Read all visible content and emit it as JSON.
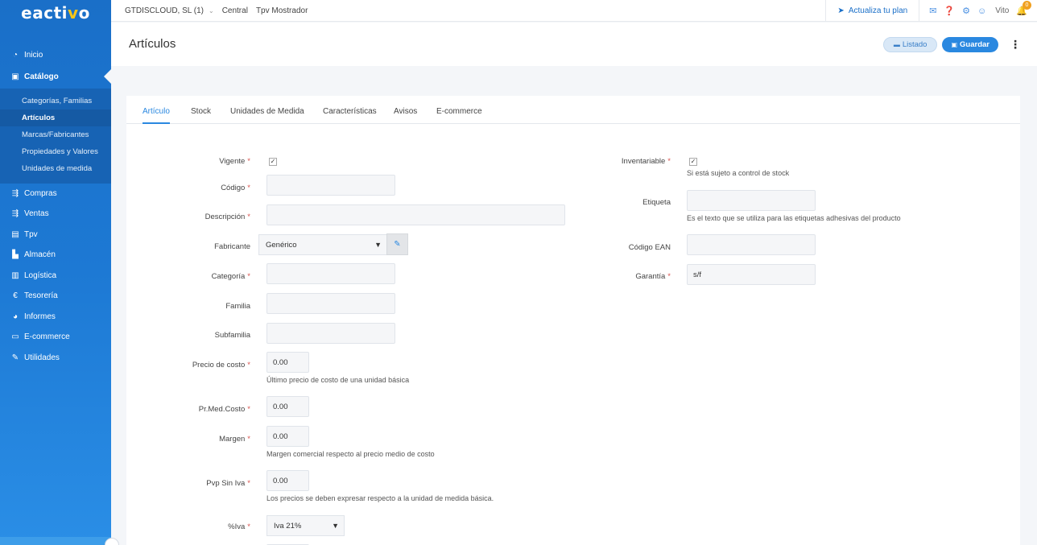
{
  "logo": {
    "text_main": "eacti",
    "text_accent": "v",
    "text_end": "o"
  },
  "topbar": {
    "company": "GTDISCLOUD, SL (1)",
    "crumbs": [
      "Central",
      "Tpv Mostrador"
    ],
    "plan_label": "Actualiza tu plan",
    "user": "Vito",
    "notifications": "0"
  },
  "sidebar": {
    "items": [
      {
        "label": "Inicio",
        "icon": "dashboard-icon"
      },
      {
        "label": "Catálogo",
        "icon": "catalog-icon"
      },
      {
        "label": "Compras",
        "icon": "purchases-icon"
      },
      {
        "label": "Ventas",
        "icon": "sales-icon"
      },
      {
        "label": "Tpv",
        "icon": "pos-icon"
      },
      {
        "label": "Almacén",
        "icon": "warehouse-icon"
      },
      {
        "label": "Logística",
        "icon": "logistics-icon"
      },
      {
        "label": "Tesorería",
        "icon": "euro-icon"
      },
      {
        "label": "Informes",
        "icon": "pie-chart-icon"
      },
      {
        "label": "E-commerce",
        "icon": "ecommerce-icon"
      },
      {
        "label": "Utilidades",
        "icon": "wrench-icon"
      }
    ],
    "catalog_sub": [
      "Categorías, Familias",
      "Artículos",
      "Marcas/Fabricantes",
      "Propiedades y Valores",
      "Unidades de medida"
    ]
  },
  "header": {
    "title": "Artículos",
    "listado_label": "Listado",
    "guardar_label": "Guardar"
  },
  "tabs": [
    "Artículo",
    "Stock",
    "Unidades de Medida",
    "Características",
    "Avisos",
    "E-commerce"
  ],
  "form": {
    "vigente": {
      "label": "Vigente",
      "checked": true
    },
    "codigo": {
      "label": "Código",
      "value": ""
    },
    "descripcion": {
      "label": "Descripción",
      "value": ""
    },
    "fabricante": {
      "label": "Fabricante",
      "value": "Genérico"
    },
    "categoria": {
      "label": "Categoría",
      "value": ""
    },
    "familia": {
      "label": "Familia",
      "value": ""
    },
    "subfamilia": {
      "label": "Subfamilia",
      "value": ""
    },
    "precio_costo": {
      "label": "Precio de costo",
      "value": "0.00",
      "help": "Último precio de costo de una unidad básica"
    },
    "pr_med_costo": {
      "label": "Pr.Med.Costo",
      "value": "0.00"
    },
    "margen": {
      "label": "Margen",
      "value": "0.00",
      "help": "Margen comercial respecto al precio medio de costo"
    },
    "pvp_sin_iva": {
      "label": "Pvp Sin Iva",
      "value": "0.00",
      "help": "Los precios se deben expresar respecto a la unidad de medida básica."
    },
    "iva": {
      "label": "%Iva",
      "value": "Iva 21%"
    },
    "inventariable": {
      "label": "Inventariable",
      "checked": true,
      "help": "Si está sujeto a control de stock"
    },
    "etiqueta": {
      "label": "Etiqueta",
      "value": "",
      "help": "Es el texto que se utiliza para las etiquetas adhesivas del producto"
    },
    "codigo_ean": {
      "label": "Código EAN",
      "value": ""
    },
    "garantia": {
      "label": "Garantía",
      "value": "s/f"
    }
  }
}
